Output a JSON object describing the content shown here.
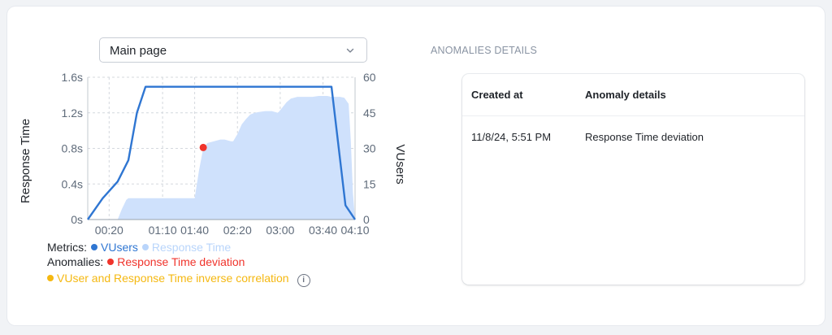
{
  "selector": {
    "value": "Main page"
  },
  "details": {
    "title": "ANOMALIES DETAILS",
    "columns": [
      "Created at",
      "Anomaly details"
    ],
    "rows": [
      {
        "created_at": "11/8/24, 5:51 PM",
        "details": "Response Time deviation"
      }
    ]
  },
  "legend": {
    "metrics_label": "Metrics:",
    "metrics": [
      {
        "name": "VUsers",
        "color": "#2f76d2"
      },
      {
        "name": "Response Time",
        "color": "#b9d5fb"
      }
    ],
    "anomalies_label": "Anomalies:",
    "anomalies": [
      {
        "name": "Response Time deviation",
        "color": "#f0342c"
      },
      {
        "name": "VUser and Response Time inverse correlation",
        "color": "#f5b811"
      }
    ],
    "info_icon": "info-icon"
  },
  "chart_data": {
    "type": "line",
    "xlabels": [
      "00:20",
      "01:10",
      "01:40",
      "02:20",
      "03:00",
      "03:40",
      "04:10"
    ],
    "xlabel_seconds": [
      20,
      70,
      100,
      140,
      180,
      220,
      250
    ],
    "xlim": [
      0,
      250
    ],
    "left_axis": {
      "label": "Response Time",
      "ticks": [
        "0s",
        "0.4s",
        "0.8s",
        "1.2s",
        "1.6s"
      ],
      "tick_values": [
        0,
        0.4,
        0.8,
        1.2,
        1.6
      ],
      "ylim": [
        0,
        1.6
      ]
    },
    "right_axis": {
      "label": "VUsers",
      "ticks": [
        "0",
        "15",
        "30",
        "45",
        "60"
      ],
      "tick_values": [
        0,
        15,
        30,
        45,
        60
      ],
      "ylim": [
        0,
        60
      ]
    },
    "series": [
      {
        "name": "VUsers",
        "axis": "right",
        "kind": "line",
        "color": "#2f76d2",
        "x": [
          0,
          14,
          28,
          38,
          46,
          54,
          180,
          215,
          228,
          241,
          250
        ],
        "y": [
          0,
          9,
          16,
          25,
          45,
          56,
          56,
          56,
          56,
          6,
          0
        ]
      },
      {
        "name": "Response Time",
        "axis": "left",
        "kind": "area",
        "color": "#cfe1fc",
        "x": [
          28,
          32,
          36,
          38,
          70,
          100,
          104,
          108,
          112,
          118,
          124,
          128,
          134,
          136,
          140,
          144,
          148,
          152,
          156,
          160,
          166,
          172,
          178,
          182,
          186,
          190,
          196,
          210,
          216,
          220,
          224,
          228,
          232,
          236,
          240,
          244,
          246,
          248,
          250
        ],
        "y": [
          0,
          0.12,
          0.22,
          0.24,
          0.24,
          0.24,
          0.55,
          0.8,
          0.86,
          0.88,
          0.9,
          0.9,
          0.88,
          0.88,
          0.96,
          1.07,
          1.13,
          1.18,
          1.2,
          1.21,
          1.22,
          1.22,
          1.2,
          1.26,
          1.32,
          1.36,
          1.38,
          1.38,
          1.39,
          1.39,
          1.39,
          1.38,
          1.38,
          1.38,
          1.37,
          1.3,
          0.9,
          0.3,
          0
        ]
      }
    ],
    "anomaly_points": [
      {
        "name": "Response Time deviation",
        "x": 108,
        "y": 0.81,
        "color": "#f0342c"
      }
    ],
    "grid": true
  }
}
